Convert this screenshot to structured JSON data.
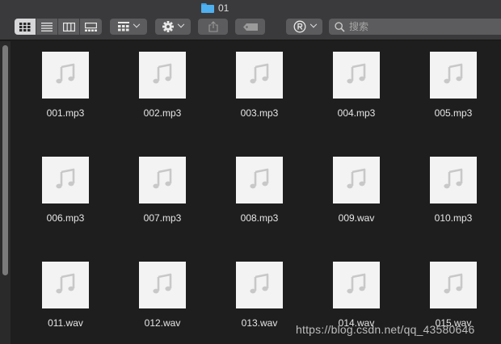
{
  "window": {
    "title": "01",
    "title_icon": "folder-icon"
  },
  "toolbar": {
    "view_modes": [
      {
        "icon": "icon-view-icon",
        "active": true
      },
      {
        "icon": "list-view-icon",
        "active": false
      },
      {
        "icon": "column-view-icon",
        "active": false
      },
      {
        "icon": "gallery-view-icon",
        "active": false
      }
    ],
    "group_icon": "group-grid-icon",
    "action_icon": "gear-icon",
    "share_icon": "share-icon",
    "tag_icon": "tag-icon",
    "registered_icon": "registered-icon",
    "search": {
      "placeholder": "搜索",
      "value": ""
    }
  },
  "files": [
    {
      "name": "001.mp3",
      "icon": "music-note-icon"
    },
    {
      "name": "002.mp3",
      "icon": "music-note-icon"
    },
    {
      "name": "003.mp3",
      "icon": "music-note-icon"
    },
    {
      "name": "004.mp3",
      "icon": "music-note-icon"
    },
    {
      "name": "005.mp3",
      "icon": "music-note-icon"
    },
    {
      "name": "006.mp3",
      "icon": "music-note-icon"
    },
    {
      "name": "007.mp3",
      "icon": "music-note-icon"
    },
    {
      "name": "008.mp3",
      "icon": "music-note-icon"
    },
    {
      "name": "009.wav",
      "icon": "music-note-icon"
    },
    {
      "name": "010.mp3",
      "icon": "music-note-icon"
    },
    {
      "name": "011.wav",
      "icon": "music-note-icon"
    },
    {
      "name": "012.wav",
      "icon": "music-note-icon"
    },
    {
      "name": "013.wav",
      "icon": "music-note-icon"
    },
    {
      "name": "014.wav",
      "icon": "music-note-icon"
    },
    {
      "name": "015.wav",
      "icon": "music-note-icon"
    }
  ],
  "watermark": "https://blog.csdn.net/qq_43580646",
  "colors": {
    "background": "#1e1e1e",
    "toolbar": "#3a3a3c",
    "folder_accent": "#4fb0f0",
    "thumb": "#f3f3f3",
    "note": "#c8c8c8"
  }
}
